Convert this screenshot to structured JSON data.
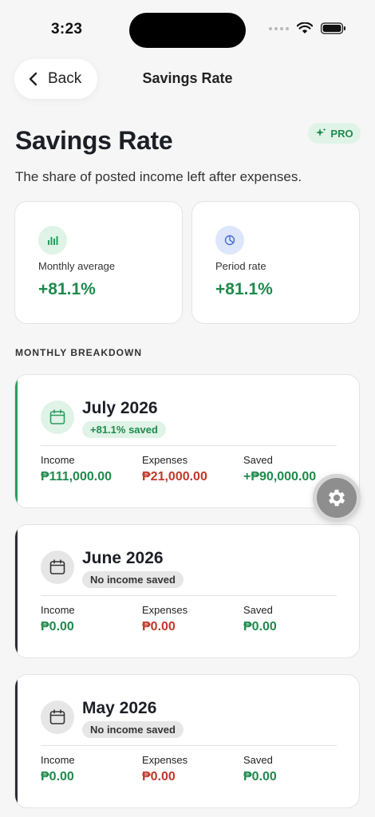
{
  "status_bar": {
    "time": "3:23"
  },
  "nav": {
    "back_label": "Back",
    "title": "Savings Rate"
  },
  "header": {
    "title": "Savings Rate",
    "pro_label": "PRO",
    "subtitle": "The share of posted income left after expenses."
  },
  "summary": [
    {
      "label": "Monthly average",
      "value": "+81.1%",
      "icon": "bar-chart-icon"
    },
    {
      "label": "Period rate",
      "value": "+81.1%",
      "icon": "pie-chart-icon"
    }
  ],
  "section_label": "MONTHLY BREAKDOWN",
  "months": [
    {
      "name": "July 2026",
      "status": "+81.1% saved",
      "income_label": "Income",
      "income": "₱111,000.00",
      "expenses_label": "Expenses",
      "expenses": "₱21,000.00",
      "saved_label": "Saved",
      "saved": "+₱90,000.00"
    },
    {
      "name": "June 2026",
      "status": "No income saved",
      "income_label": "Income",
      "income": "₱0.00",
      "expenses_label": "Expenses",
      "expenses": "₱0.00",
      "saved_label": "Saved",
      "saved": "₱0.00"
    },
    {
      "name": "May 2026",
      "status": "No income saved",
      "income_label": "Income",
      "income": "₱0.00",
      "expenses_label": "Expenses",
      "expenses": "₱0.00",
      "saved_label": "Saved",
      "saved": "₱0.00"
    }
  ],
  "colors": {
    "accent_green": "#1f8a4c",
    "expense_red": "#c0392b",
    "dark_accent": "#2a2d33"
  }
}
